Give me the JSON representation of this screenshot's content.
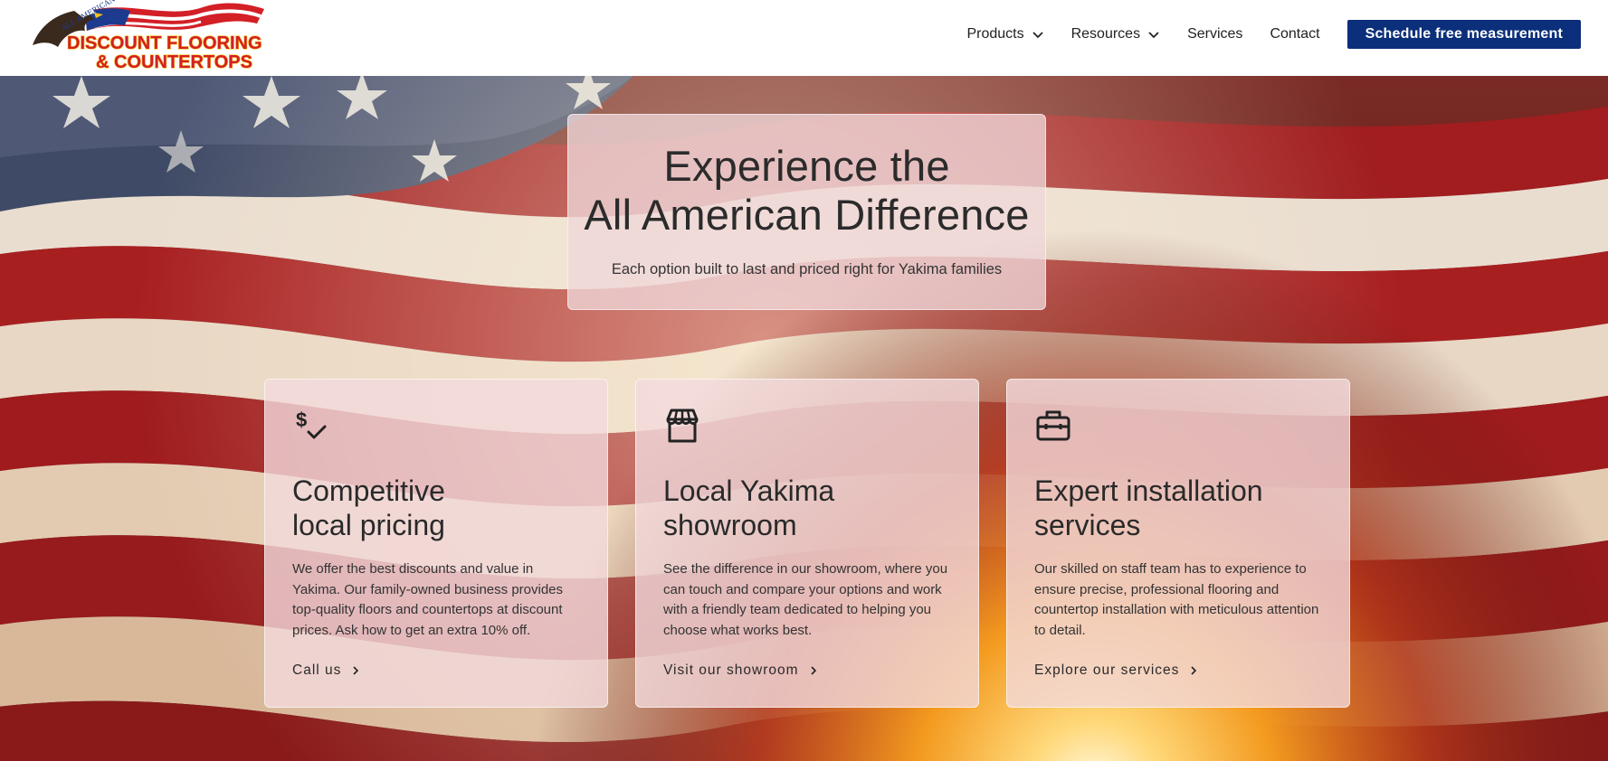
{
  "header": {
    "logo": {
      "top_text": "ALL AMERICAN",
      "line1": "DISCOUNT FLOORING",
      "line2": "& COUNTERTOPS",
      "icon": "eagle-flag-logo"
    },
    "nav": [
      {
        "label": "Products",
        "has_dropdown": true
      },
      {
        "label": "Resources",
        "has_dropdown": true
      },
      {
        "label": "Services",
        "has_dropdown": false
      },
      {
        "label": "Contact",
        "has_dropdown": false
      }
    ],
    "cta_label": "Schedule free measurement"
  },
  "hero": {
    "title_line1": "Experience the",
    "title_line2": "All American Difference",
    "subtitle": "Each option built to last and priced right for Yakima families",
    "cards": [
      {
        "icon": "dollar-check-icon",
        "title_line1": "Competitive",
        "title_line2": "local pricing",
        "body": "We offer the best discounts and value in Yakima. Our family-owned business provides top-quality floors and countertops at discount prices. Ask how to get an extra 10% off.",
        "link": "Call us"
      },
      {
        "icon": "storefront-icon",
        "title_line1": "Local Yakima",
        "title_line2": "showroom",
        "body": "See the difference in our showroom, where you can touch and compare your options and work with a friendly team dedicated to helping you choose what works best.",
        "link": "Visit our showroom"
      },
      {
        "icon": "toolbox-icon",
        "title_line1": "Expert installation",
        "title_line2": "services",
        "body": "Our skilled on staff team has to experience to ensure precise, professional flooring and countertop installation with meticulous attention to detail.",
        "link": "Explore our services"
      }
    ]
  },
  "colors": {
    "cta_bg": "#0b2f7a",
    "logo_red": "#d31f26",
    "logo_yellow": "#f6c21a",
    "flag_red": "#9c1c1c",
    "sun_orange": "#f39a1f"
  }
}
